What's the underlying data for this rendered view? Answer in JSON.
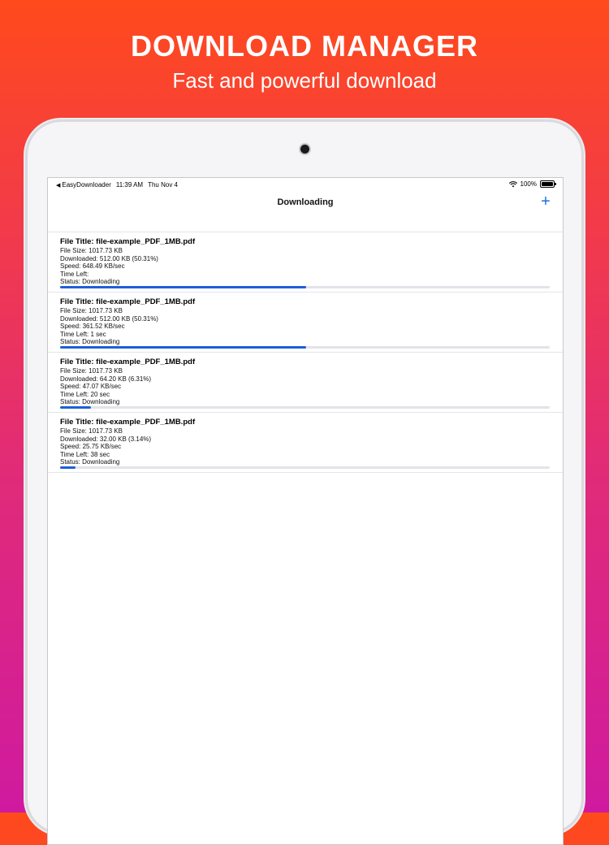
{
  "promo": {
    "title": "DOWNLOAD MANAGER",
    "subtitle": "Fast and powerful download"
  },
  "status_bar": {
    "back_app": "EasyDownloader",
    "time": "11:39 AM",
    "date": "Thu Nov 4",
    "battery": "100%"
  },
  "nav": {
    "title": "Downloading",
    "add_icon": "plus-icon",
    "add_label": "+"
  },
  "colors": {
    "accent": "#1e60d6",
    "bg_top": "#ff4a1c",
    "bg_bottom": "#cf1aa0"
  },
  "downloads": [
    {
      "title": "File Title: file-example_PDF_1MB.pdf",
      "size": "File Size: 1017.73 KB",
      "downloaded": "Downloaded: 512.00 KB (50.31%)",
      "speed": "Speed: 648.49 KB/sec",
      "time_left": "Time Left:",
      "status": "Status: Downloading",
      "progress": 0.5031
    },
    {
      "title": "File Title: file-example_PDF_1MB.pdf",
      "size": "File Size: 1017.73 KB",
      "downloaded": "Downloaded: 512.00 KB (50.31%)",
      "speed": "Speed: 361.52 KB/sec",
      "time_left": "Time Left: 1 sec",
      "status": "Status: Downloading",
      "progress": 0.5031
    },
    {
      "title": "File Title: file-example_PDF_1MB.pdf",
      "size": "File Size: 1017.73 KB",
      "downloaded": "Downloaded: 64.20 KB (6.31%)",
      "speed": "Speed: 47.07 KB/sec",
      "time_left": "Time Left: 20 sec",
      "status": "Status: Downloading",
      "progress": 0.0631
    },
    {
      "title": "File Title: file-example_PDF_1MB.pdf",
      "size": "File Size: 1017.73 KB",
      "downloaded": "Downloaded: 32.00 KB (3.14%)",
      "speed": "Speed: 25.75 KB/sec",
      "time_left": "Time Left: 38 sec",
      "status": "Status: Downloading",
      "progress": 0.0314
    }
  ]
}
